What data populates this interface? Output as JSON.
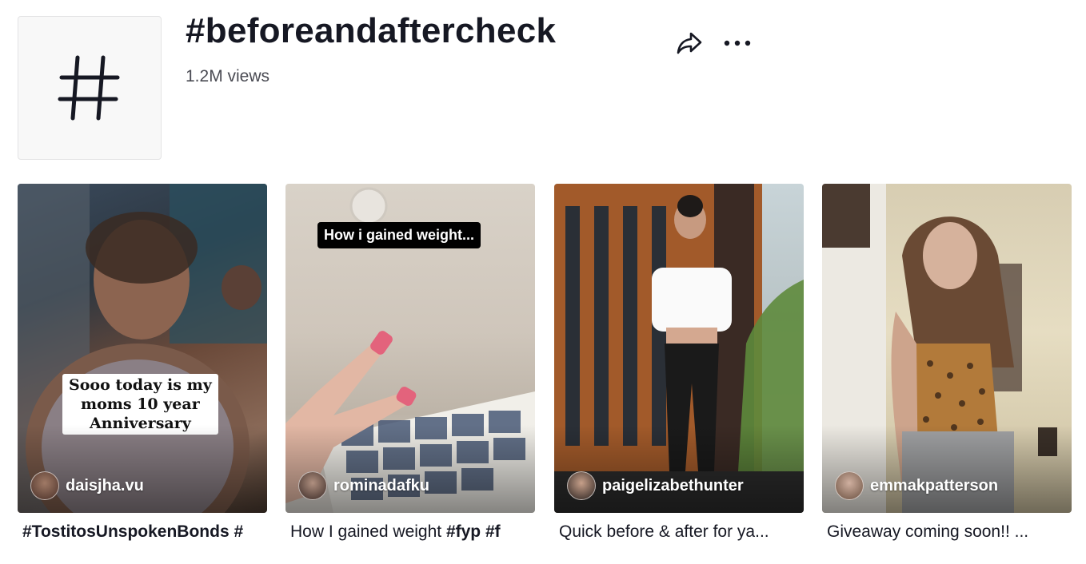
{
  "header": {
    "title": "#beforeandaftercheck",
    "views": "1.2M views",
    "icons": {
      "avatar": "hashtag-icon",
      "share": "share-icon",
      "more": "more-icon"
    }
  },
  "videos": [
    {
      "author": "daisjha.vu",
      "overlay_text": "Sooo today is my\nmoms 10 year\nAnniversary",
      "caption_bold": "#TostitosUnspokenBonds #",
      "caption_plain": ""
    },
    {
      "author": "rominadafku",
      "overlay_text": "How i gained weight...",
      "caption_plain": "How I gained weight ",
      "caption_bold": "#fyp #f"
    },
    {
      "author": "paigelizabethunter",
      "caption_plain": "Quick before & after for ya..."
    },
    {
      "author": "emmakpatterson",
      "caption_plain": "Giveaway coming soon!! ..."
    }
  ]
}
